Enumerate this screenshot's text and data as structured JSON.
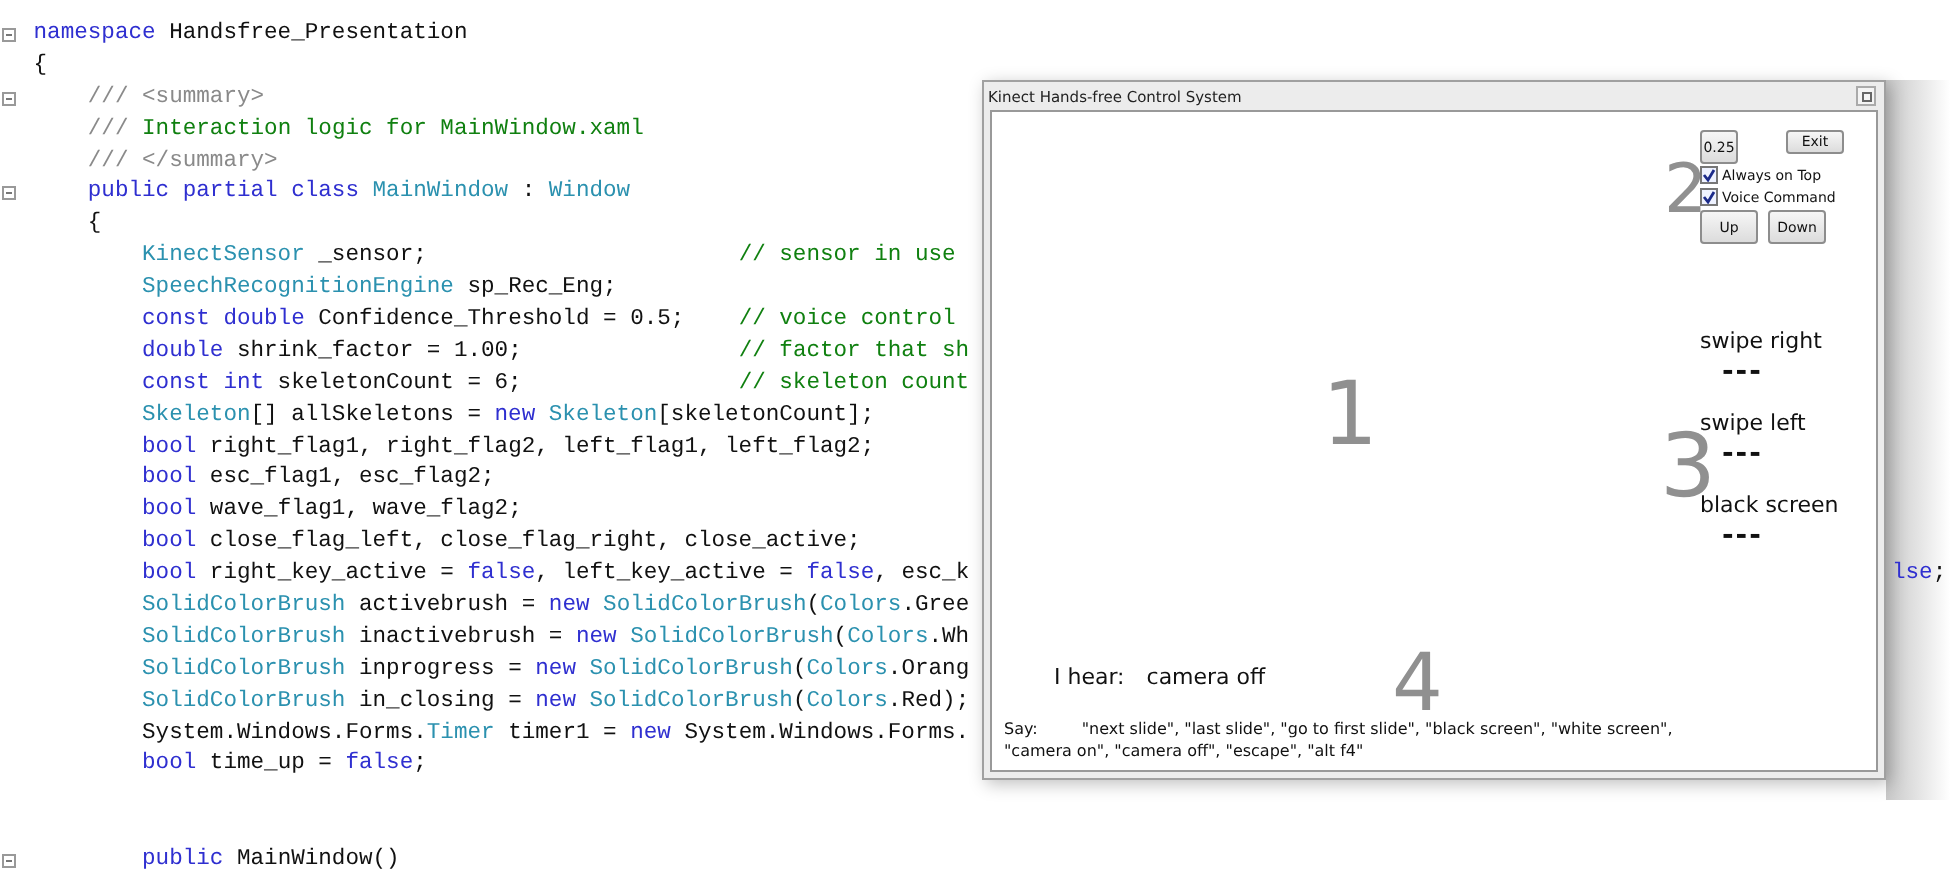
{
  "code_lines": [
    {
      "fold": true,
      "tokens": [
        {
          "kind": "keyword",
          "text": "namespace"
        },
        {
          "kind": "plain",
          "text": " Handsfree_Presentation"
        }
      ]
    },
    {
      "fold": false,
      "tokens": [
        {
          "kind": "plain",
          "text": "{"
        }
      ]
    },
    {
      "fold": true,
      "tokens": [
        {
          "kind": "doc",
          "text": "    /// <summary>"
        }
      ]
    },
    {
      "fold": false,
      "tokens": [
        {
          "kind": "doc",
          "text": "    ///"
        },
        {
          "kind": "comment",
          "text": " Interaction logic for MainWindow.xaml"
        }
      ]
    },
    {
      "fold": false,
      "tokens": [
        {
          "kind": "doc",
          "text": "    /// </summary>"
        }
      ]
    },
    {
      "fold": true,
      "tokens": [
        {
          "kind": "keyword",
          "text": "    public partial class"
        },
        {
          "kind": "type",
          "text": " MainWindow"
        },
        {
          "kind": "plain",
          "text": " : "
        },
        {
          "kind": "type",
          "text": "Window"
        }
      ]
    },
    {
      "fold": false,
      "tokens": [
        {
          "kind": "plain",
          "text": "    {"
        }
      ]
    },
    {
      "fold": false,
      "tokens": [
        {
          "kind": "type",
          "text": "        KinectSensor"
        },
        {
          "kind": "plain",
          "text": " _sensor;                       "
        },
        {
          "kind": "comment",
          "text": "// sensor in use"
        }
      ]
    },
    {
      "fold": false,
      "tokens": [
        {
          "kind": "type",
          "text": "        SpeechRecognitionEngine"
        },
        {
          "kind": "plain",
          "text": " sp_Rec_Eng;"
        }
      ]
    },
    {
      "fold": false,
      "tokens": [
        {
          "kind": "keyword",
          "text": "        const double"
        },
        {
          "kind": "plain",
          "text": " Confidence_Threshold = 0.5;    "
        },
        {
          "kind": "comment",
          "text": "// voice control"
        }
      ]
    },
    {
      "fold": false,
      "tokens": [
        {
          "kind": "keyword",
          "text": "        double"
        },
        {
          "kind": "plain",
          "text": " shrink_factor = 1.00;                "
        },
        {
          "kind": "comment",
          "text": "// factor that sh"
        }
      ]
    },
    {
      "fold": false,
      "tokens": [
        {
          "kind": "keyword",
          "text": "        const int"
        },
        {
          "kind": "plain",
          "text": " skeletonCount = 6;                "
        },
        {
          "kind": "comment",
          "text": "// skeleton count"
        }
      ]
    },
    {
      "fold": false,
      "tokens": [
        {
          "kind": "type",
          "text": "        Skeleton"
        },
        {
          "kind": "plain",
          "text": "[] allSkeletons = "
        },
        {
          "kind": "keyword",
          "text": "new"
        },
        {
          "kind": "type",
          "text": " Skeleton"
        },
        {
          "kind": "plain",
          "text": "[skeletonCount];"
        }
      ]
    },
    {
      "fold": false,
      "tokens": [
        {
          "kind": "keyword",
          "text": "        bool"
        },
        {
          "kind": "plain",
          "text": " right_flag1, right_flag2, left_flag1, left_flag2;"
        }
      ]
    },
    {
      "fold": false,
      "tokens": [
        {
          "kind": "keyword",
          "text": "        bool"
        },
        {
          "kind": "plain",
          "text": " esc_flag1, esc_flag2;"
        }
      ]
    },
    {
      "fold": false,
      "tokens": [
        {
          "kind": "keyword",
          "text": "        bool"
        },
        {
          "kind": "plain",
          "text": " wave_flag1, wave_flag2;"
        }
      ]
    },
    {
      "fold": false,
      "tokens": [
        {
          "kind": "keyword",
          "text": "        bool"
        },
        {
          "kind": "plain",
          "text": " close_flag_left, close_flag_right, close_active;"
        }
      ]
    },
    {
      "fold": false,
      "tokens": [
        {
          "kind": "keyword",
          "text": "        bool"
        },
        {
          "kind": "plain",
          "text": " right_key_active = "
        },
        {
          "kind": "keyword",
          "text": "false"
        },
        {
          "kind": "plain",
          "text": ", left_key_active = "
        },
        {
          "kind": "keyword",
          "text": "false"
        },
        {
          "kind": "plain",
          "text": ", esc_k"
        }
      ],
      "tail": [
        {
          "kind": "keyword",
          "text": "lse"
        },
        {
          "kind": "plain",
          "text": ";"
        }
      ]
    },
    {
      "fold": false,
      "tokens": [
        {
          "kind": "type",
          "text": "        SolidColorBrush"
        },
        {
          "kind": "plain",
          "text": " activebrush = "
        },
        {
          "kind": "keyword",
          "text": "new"
        },
        {
          "kind": "type",
          "text": " SolidColorBrush"
        },
        {
          "kind": "plain",
          "text": "("
        },
        {
          "kind": "type",
          "text": "Colors"
        },
        {
          "kind": "plain",
          "text": ".Gree"
        }
      ]
    },
    {
      "fold": false,
      "tokens": [
        {
          "kind": "type",
          "text": "        SolidColorBrush"
        },
        {
          "kind": "plain",
          "text": " inactivebrush = "
        },
        {
          "kind": "keyword",
          "text": "new"
        },
        {
          "kind": "type",
          "text": " SolidColorBrush"
        },
        {
          "kind": "plain",
          "text": "("
        },
        {
          "kind": "type",
          "text": "Colors"
        },
        {
          "kind": "plain",
          "text": ".Wh"
        }
      ]
    },
    {
      "fold": false,
      "tokens": [
        {
          "kind": "type",
          "text": "        SolidColorBrush"
        },
        {
          "kind": "plain",
          "text": " inprogress = "
        },
        {
          "kind": "keyword",
          "text": "new"
        },
        {
          "kind": "type",
          "text": " SolidColorBrush"
        },
        {
          "kind": "plain",
          "text": "("
        },
        {
          "kind": "type",
          "text": "Colors"
        },
        {
          "kind": "plain",
          "text": ".Orang"
        }
      ]
    },
    {
      "fold": false,
      "tokens": [
        {
          "kind": "type",
          "text": "        SolidColorBrush"
        },
        {
          "kind": "plain",
          "text": " in_closing = "
        },
        {
          "kind": "keyword",
          "text": "new"
        },
        {
          "kind": "type",
          "text": " SolidColorBrush"
        },
        {
          "kind": "plain",
          "text": "("
        },
        {
          "kind": "type",
          "text": "Colors"
        },
        {
          "kind": "plain",
          "text": ".Red);"
        }
      ]
    },
    {
      "fold": false,
      "tokens": [
        {
          "kind": "plain",
          "text": "        System.Windows.Forms."
        },
        {
          "kind": "type",
          "text": "Timer"
        },
        {
          "kind": "plain",
          "text": " timer1 = "
        },
        {
          "kind": "keyword",
          "text": "new"
        },
        {
          "kind": "plain",
          "text": " System.Windows.Forms."
        }
      ]
    },
    {
      "fold": false,
      "tokens": [
        {
          "kind": "keyword",
          "text": "        bool"
        },
        {
          "kind": "plain",
          "text": " time_up = "
        },
        {
          "kind": "keyword",
          "text": "false"
        },
        {
          "kind": "plain",
          "text": ";"
        }
      ]
    },
    {
      "fold": false
    },
    {
      "fold": false
    },
    {
      "fold": true,
      "tokens": [
        {
          "kind": "keyword",
          "text": "        public"
        },
        {
          "kind": "plain",
          "text": " MainWindow()"
        }
      ]
    }
  ],
  "window": {
    "title": "Kinect Hands-free Control System",
    "speed_button": "0.25",
    "exit_button": "Exit",
    "options": [
      {
        "label": "Always on Top",
        "checked": true
      },
      {
        "label": "Voice Command",
        "checked": true
      }
    ],
    "nav_buttons": [
      "Up",
      "Down"
    ],
    "gestures": [
      {
        "label": "swipe right",
        "indicator": "---"
      },
      {
        "label": "swipe left",
        "indicator": "---"
      },
      {
        "label": "black screen",
        "indicator": "---"
      }
    ],
    "hear_label": "I hear:",
    "hear_value": "camera off",
    "say_label": "Say:",
    "say_text": "\"next slide\", \"last slide\", \"go to first slide\", \"black screen\", \"white screen\", \"camera on\", \"camera off\", \"escape\", \"alt f4\""
  },
  "markers": [
    "1",
    "2",
    "3",
    "4"
  ]
}
